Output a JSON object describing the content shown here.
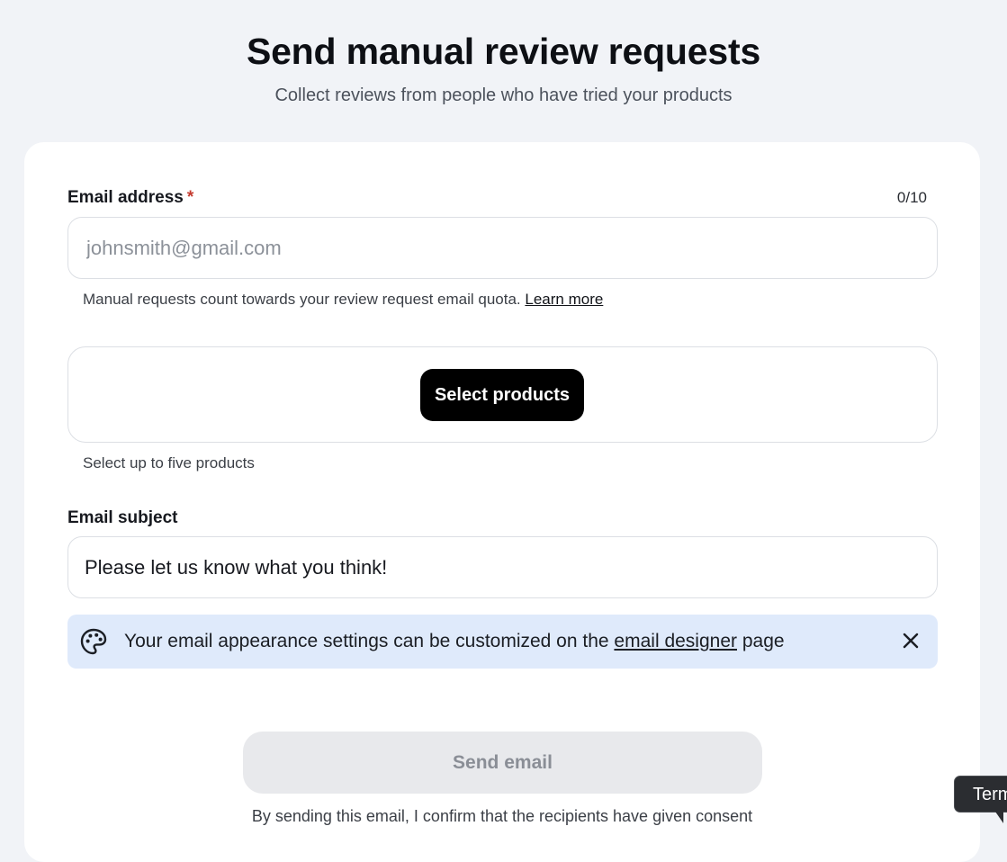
{
  "header": {
    "title": "Send manual review requests",
    "subtitle": "Collect reviews from people who have tried your products"
  },
  "email_field": {
    "label": "Email address",
    "required_mark": "*",
    "counter": "0/10",
    "value": "",
    "placeholder": "johnsmith@gmail.com",
    "help_text": "Manual requests count towards your review request email quota.",
    "help_link": "Learn more"
  },
  "products": {
    "button_label": "Select products",
    "help_text": "Select up to five products"
  },
  "subject_field": {
    "label": "Email subject",
    "value": "Please let us know what you think!"
  },
  "banner": {
    "icon": "palette-icon",
    "text_before": "Your email appearance settings can be customized on the",
    "link": "email designer",
    "text_after": "page",
    "close_icon": "close-icon"
  },
  "footer": {
    "send_label": "Send email",
    "consent_text": "By sending this email, I confirm that the recipients have given consent"
  },
  "terms_tab": {
    "label": "Terms"
  },
  "colors": {
    "background": "#f1f3f7",
    "card": "#ffffff",
    "primary_button": "#000000",
    "disabled_button": "#e8e9ec",
    "banner": "#dfeafb",
    "required": "#c43b2f"
  }
}
